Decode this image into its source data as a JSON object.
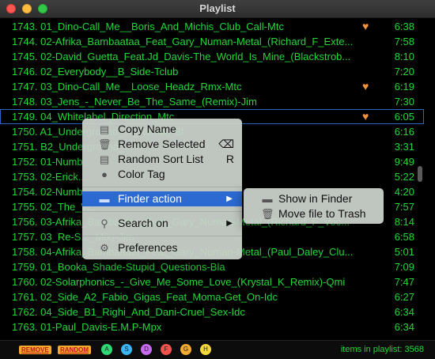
{
  "window": {
    "title": "Playlist"
  },
  "tracks": [
    {
      "label": "1743. 01_Dino-Call_Me__Boris_And_Michis_Club_Call-Mtc",
      "duration": "6:38",
      "heart": true
    },
    {
      "label": "1744. 02-Afrika_Bambaataa_Feat_Gary_Numan-Metal_(Richard_F_Exte...",
      "duration": "7:58",
      "heart": false
    },
    {
      "label": "1745. 02-David_Guetta_Feat.Jd_Davis-The_World_Is_Mine_(Blackstrob...",
      "duration": "8:10",
      "heart": false
    },
    {
      "label": "1746. 02_Everybody__B_Side-Tclub",
      "duration": "7:20",
      "heart": false
    },
    {
      "label": "1747. 03_Dino-Call_Me__Loose_Headz_Rmx-Mtc",
      "duration": "6:19",
      "heart": true
    },
    {
      "label": "1748. 03_Jens_-_Never_Be_The_Same_(Remix)-Jim",
      "duration": "7:30",
      "heart": false
    },
    {
      "label": "1749. 04_Whitelabel_Direction_Mtc",
      "duration": "6:05",
      "heart": true,
      "selected": true
    },
    {
      "label": "1750. A1_Underground_..._Remix)-Bf",
      "duration": "6:16",
      "heart": false
    },
    {
      "label": "1751. B2_Underground_...",
      "duration": "3:31",
      "heart": false
    },
    {
      "label": "1752. 01-Numb...",
      "duration": "9:49",
      "heart": false
    },
    {
      "label": "1753. 02-Erick...",
      "duration": "5:22",
      "heart": false
    },
    {
      "label": "1754. 02-Numb...",
      "duration": "4:20",
      "heart": false
    },
    {
      "label": "1755. 02_The_W...",
      "duration": "7:57",
      "heart": false
    },
    {
      "label": "1756. 03-Afrika_Bambaataa_Feat_Gary_Numan-Metal_(Richard_F_Voc...",
      "duration": "8:14",
      "heart": false
    },
    {
      "label": "1757. 03_Re-S..._Mix)-Jim",
      "duration": "6:58",
      "heart": false
    },
    {
      "label": "1758. 04-Afrika_Bambaataa_Feat_Gary_Numan-Metal_(Paul_Daley_Clu...",
      "duration": "5:01",
      "heart": false
    },
    {
      "label": "1759. 01_Booka_Shade-Stupid_Questions-Bla",
      "duration": "7:09",
      "heart": false
    },
    {
      "label": "1760. 02-Solarphonics_-_Give_Me_Some_Love_(Krystal_K_Remix)-Qmi",
      "duration": "7:47",
      "heart": false
    },
    {
      "label": "1761. 02_Side_A2_Fabio_Gigas_Feat_Moma-Get_On-Idc",
      "duration": "6:27",
      "heart": false
    },
    {
      "label": "1762. 04_Side_B1_Righi_And_Dani-Cruel_Sex-Idc",
      "duration": "6:34",
      "heart": false
    },
    {
      "label": "1763. 01-Paul_Davis-E.M.P-Mpx",
      "duration": "6:34",
      "heart": false
    }
  ],
  "context_menu": {
    "items": [
      {
        "label": "Copy Name",
        "icon": "document-icon",
        "shortcut": ""
      },
      {
        "label": "Remove Selected",
        "icon": "trash-icon",
        "shortcut": "⌫"
      },
      {
        "label": "Random Sort List",
        "icon": "document-icon",
        "shortcut": "R"
      },
      {
        "label": "Color Tag",
        "icon": "circle-icon",
        "shortcut": ""
      },
      {
        "label": "Finder action",
        "icon": "folder-icon",
        "submenu": true,
        "highlighted": true
      },
      {
        "label": "Search on",
        "icon": "magnifier-icon",
        "submenu": true
      },
      {
        "label": "Preferences",
        "icon": "gear-icon"
      }
    ]
  },
  "submenu": {
    "items": [
      {
        "label": "Show in Finder",
        "icon": "folder-icon"
      },
      {
        "label": "Move file to Trash",
        "icon": "trash-icon"
      }
    ]
  },
  "bottom": {
    "remove_label": "REMOVE",
    "random_label": "RANDOM",
    "tag_buttons": [
      {
        "letter": "A",
        "color": "#2fd873"
      },
      {
        "letter": "S",
        "color": "#3ab5f5"
      },
      {
        "letter": "D",
        "color": "#c86af0"
      },
      {
        "letter": "F",
        "color": "#f2544d"
      },
      {
        "letter": "G",
        "color": "#f2ab2e"
      },
      {
        "letter": "H",
        "color": "#f2d83a"
      }
    ],
    "count_text": "items in playlist: 3568"
  },
  "colors": {
    "text_green": "#22d839",
    "heart": "#f3923a",
    "selection_blue": "#2c69d0"
  }
}
